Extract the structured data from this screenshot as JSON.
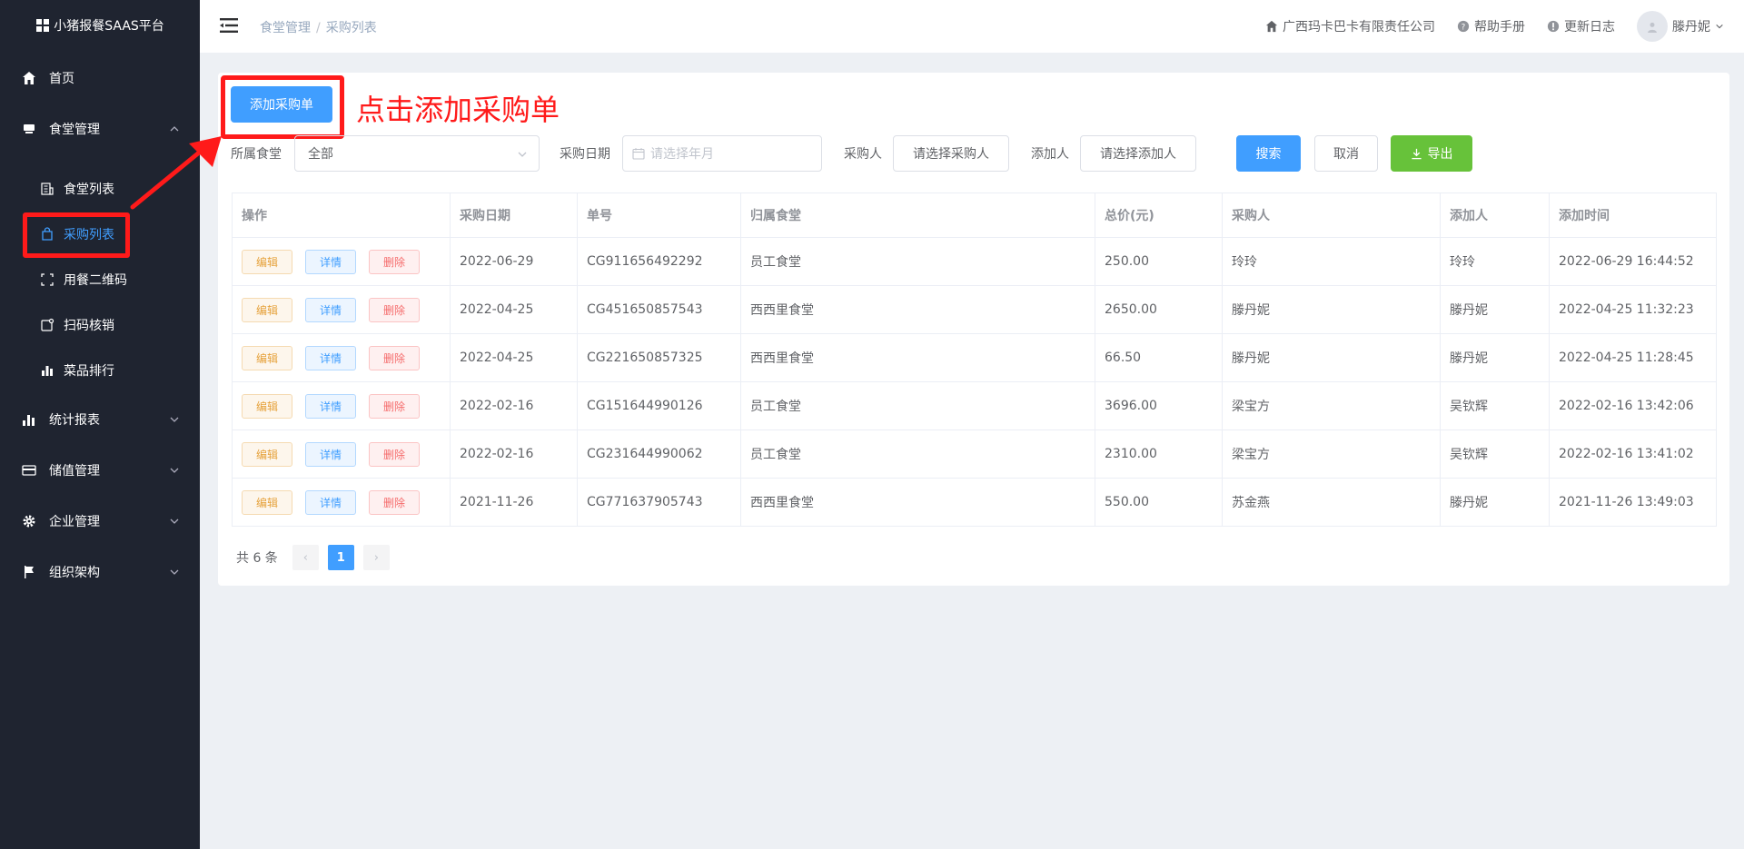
{
  "app": {
    "title": "小猪报餐SAAS平台"
  },
  "sidebar": {
    "items": [
      {
        "label": "首页"
      },
      {
        "label": "食堂管理"
      },
      {
        "label": "统计报表"
      },
      {
        "label": "储值管理"
      },
      {
        "label": "企业管理"
      },
      {
        "label": "组织架构"
      }
    ],
    "sub_items": [
      {
        "label": "食堂列表"
      },
      {
        "label": "采购列表"
      },
      {
        "label": "用餐二维码"
      },
      {
        "label": "扫码核销"
      },
      {
        "label": "菜品排行"
      }
    ]
  },
  "header": {
    "breadcrumb": [
      "食堂管理",
      "采购列表"
    ],
    "breadcrumb_sep": "/",
    "company": "广西玛卡巴卡有限责任公司",
    "help": "帮助手册",
    "changelog": "更新日志",
    "user": "滕丹妮"
  },
  "toolbar": {
    "add_label": "添加采购单",
    "annotation": "点击添加采购单"
  },
  "filters": {
    "canteen_label": "所属食堂",
    "canteen_value": "全部",
    "date_label": "采购日期",
    "date_placeholder": "请选择年月",
    "buyer_label": "采购人",
    "buyer_button": "请选择采购人",
    "adder_label": "添加人",
    "adder_button": "请选择添加人",
    "search_label": "搜索",
    "cancel_label": "取消",
    "export_label": "导出"
  },
  "table": {
    "columns": [
      "操作",
      "采购日期",
      "单号",
      "归属食堂",
      "总价(元)",
      "采购人",
      "添加人",
      "添加时间"
    ],
    "actions": {
      "edit": "编辑",
      "detail": "详情",
      "delete": "删除"
    },
    "rows": [
      {
        "date": "2022-06-29",
        "no": "CG911656492292",
        "canteen": "员工食堂",
        "total": "250.00",
        "buyer": "玲玲",
        "adder": "玲玲",
        "time": "2022-06-29 16:44:52"
      },
      {
        "date": "2022-04-25",
        "no": "CG451650857543",
        "canteen": "西西里食堂",
        "total": "2650.00",
        "buyer": "滕丹妮",
        "adder": "滕丹妮",
        "time": "2022-04-25 11:32:23"
      },
      {
        "date": "2022-04-25",
        "no": "CG221650857325",
        "canteen": "西西里食堂",
        "total": "66.50",
        "buyer": "滕丹妮",
        "adder": "滕丹妮",
        "time": "2022-04-25 11:28:45"
      },
      {
        "date": "2022-02-16",
        "no": "CG151644990126",
        "canteen": "员工食堂",
        "total": "3696.00",
        "buyer": "梁宝方",
        "adder": "吴钦辉",
        "time": "2022-02-16 13:42:06"
      },
      {
        "date": "2022-02-16",
        "no": "CG231644990062",
        "canteen": "员工食堂",
        "total": "2310.00",
        "buyer": "梁宝方",
        "adder": "吴钦辉",
        "time": "2022-02-16 13:41:02"
      },
      {
        "date": "2021-11-26",
        "no": "CG771637905743",
        "canteen": "西西里食堂",
        "total": "550.00",
        "buyer": "苏金燕",
        "adder": "滕丹妮",
        "time": "2021-11-26 13:49:03"
      }
    ]
  },
  "pagination": {
    "total_text": "共 6 条",
    "current": "1",
    "prev": "‹",
    "next": "›"
  },
  "colors": {
    "primary": "#409eff",
    "success": "#67c23a",
    "annotation": "#ff1a1a",
    "sidebar": "#1f2430"
  }
}
